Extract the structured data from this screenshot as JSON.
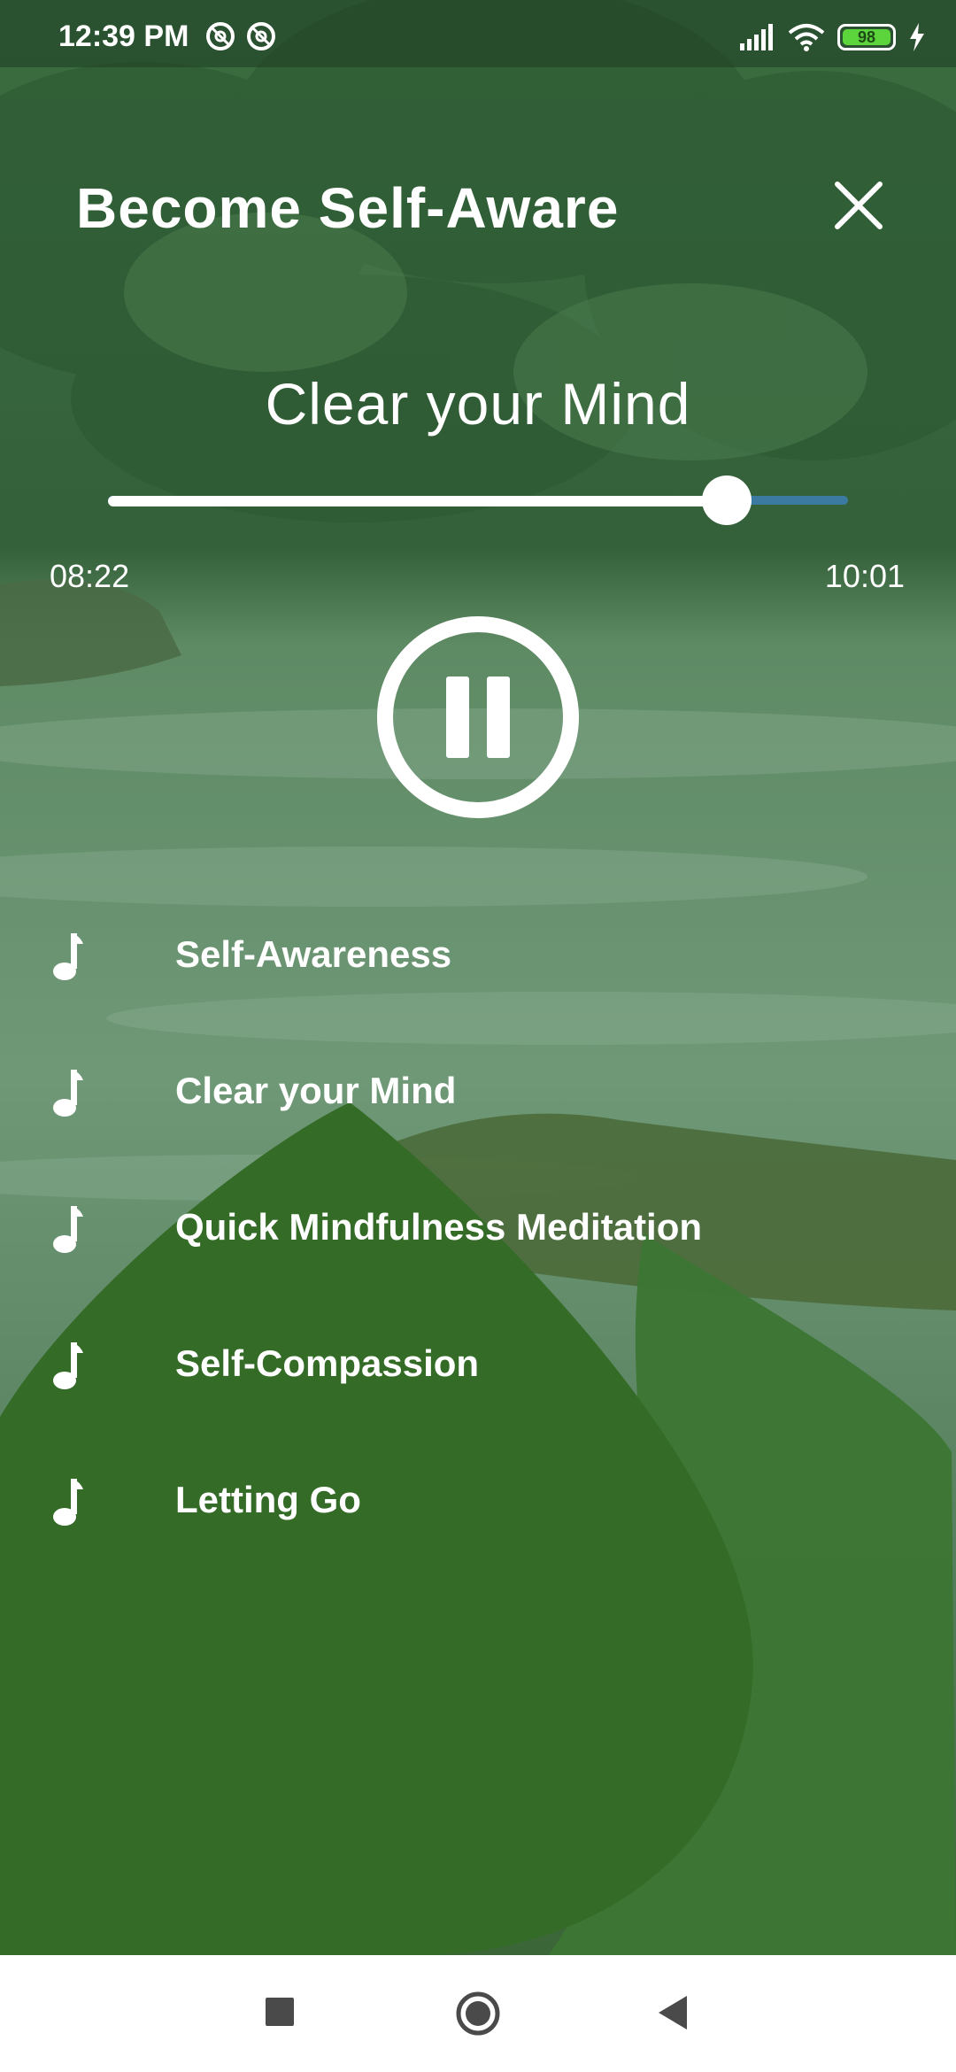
{
  "status_bar": {
    "time": "12:39 PM",
    "battery_level": "98",
    "icons": [
      "at-sign-icon",
      "at-sign-icon",
      "signal-icon",
      "wifi-icon",
      "battery-icon",
      "charging-icon"
    ]
  },
  "header": {
    "title": "Become Self-Aware",
    "close_icon": "close-icon"
  },
  "player": {
    "current_track": "Clear your Mind",
    "progress_fraction": 0.836,
    "elapsed": "08:22",
    "total": "10:01",
    "state": "playing",
    "control_icon": "pause-icon"
  },
  "playlist": {
    "items": [
      {
        "label": "Self-Awareness",
        "icon": "music-note-icon"
      },
      {
        "label": "Clear your Mind",
        "icon": "music-note-icon"
      },
      {
        "label": "Quick Mindfulness Meditation",
        "icon": "music-note-icon"
      },
      {
        "label": "Self-Compassion",
        "icon": "music-note-icon"
      },
      {
        "label": "Letting Go",
        "icon": "music-note-icon"
      }
    ]
  },
  "nav_bar": {
    "buttons": [
      "recent-apps-icon",
      "home-icon",
      "back-icon"
    ]
  },
  "colors": {
    "leaf_dark": "#346b27",
    "leaf_light": "#3d7534",
    "slider_fill": "#ffffff",
    "slider_rail": "#3d7aa2",
    "battery": "#5cd43b"
  }
}
